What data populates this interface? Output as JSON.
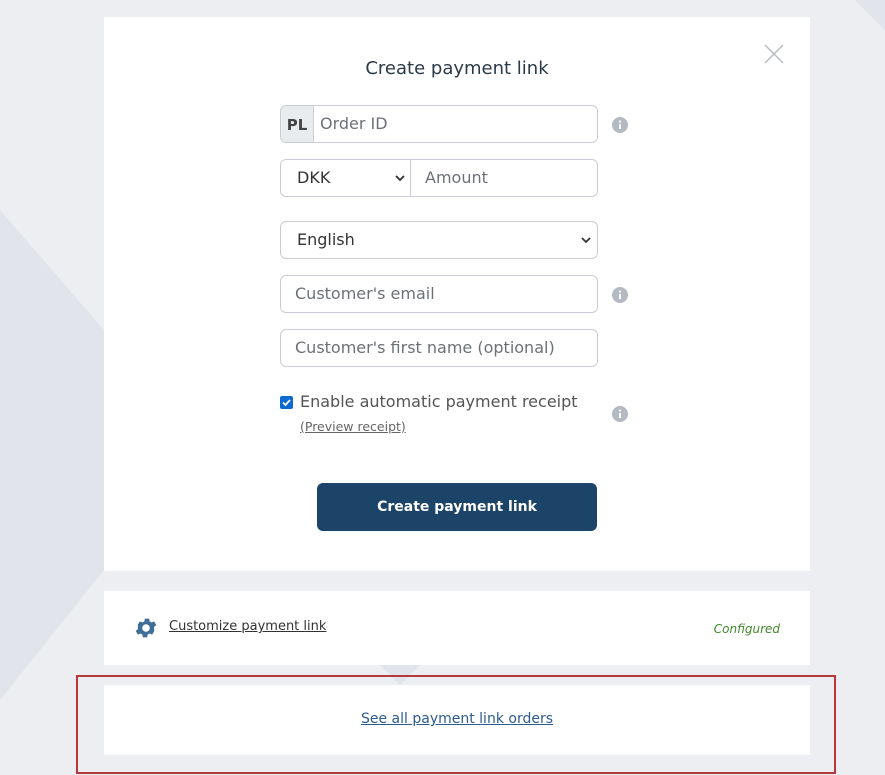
{
  "dialog": {
    "title": "Create payment link",
    "order_prefix": "PL",
    "order_placeholder": "Order ID",
    "currency_value": "DKK",
    "amount_placeholder": "Amount",
    "language_value": "English",
    "email_placeholder": "Customer's email",
    "first_name_placeholder": "Customer's first name (optional)",
    "receipt_checkbox_checked": true,
    "receipt_label": "Enable automatic payment receipt",
    "preview_receipt_label": "(Preview receipt)",
    "create_button_label": "Create payment link"
  },
  "customize": {
    "link_label": "Customize payment link",
    "status": "Configured"
  },
  "orders": {
    "link_label": "See all payment link orders"
  },
  "icons": {
    "close": "close-icon",
    "info": "info-icon",
    "gear": "gear-icon",
    "chevron": "chevron-down-icon"
  },
  "colors": {
    "primary": "#1c4468",
    "link": "#2d5c8f",
    "configured": "#3f8a2b",
    "highlight": "#b53a3a",
    "background": "#eceef2"
  }
}
